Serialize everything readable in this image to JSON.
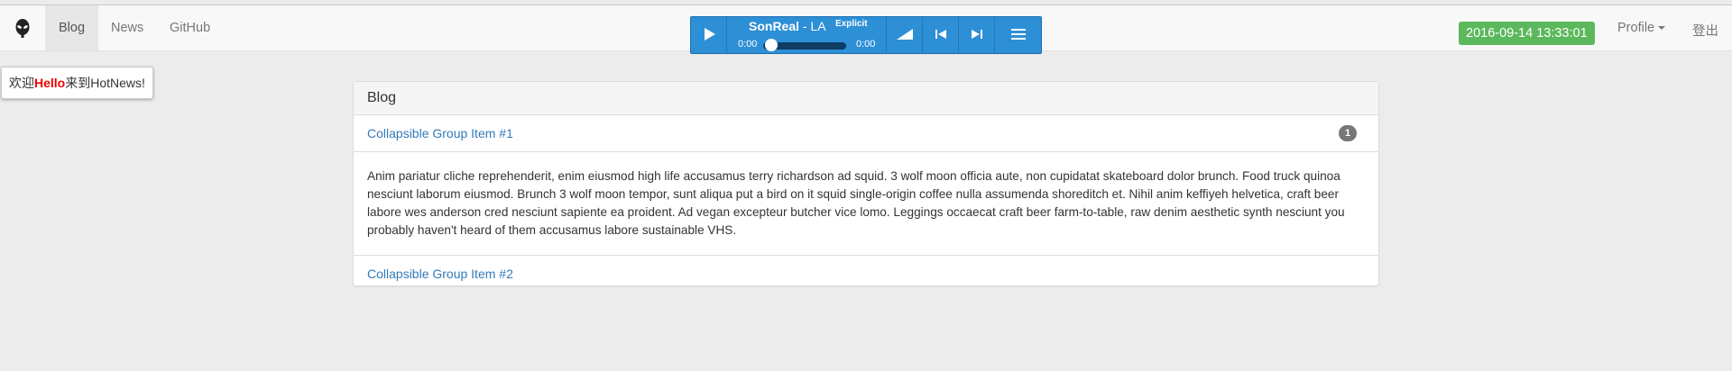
{
  "navbar": {
    "brand_icon": "alien-icon",
    "items": [
      {
        "label": "Blog",
        "active": true
      },
      {
        "label": "News",
        "active": false
      },
      {
        "label": "GitHub",
        "active": false
      }
    ],
    "clock": "2016-09-14 13:33:01",
    "profile_label": "Profile",
    "logout_label": "登出"
  },
  "player": {
    "artist": "SonReal",
    "separator": " - ",
    "title": "LA",
    "explicit_label": "Explicit",
    "time_current": "0:00",
    "time_total": "0:00",
    "progress": 0,
    "colors": {
      "background": "#2d8fd6",
      "track": "#0e3c63"
    }
  },
  "welcome": {
    "prefix": "欢迎",
    "name": "Hello",
    "suffix": "来到HotNews!"
  },
  "panel": {
    "title": "Blog",
    "groups": [
      {
        "label": "Collapsible Group Item #1",
        "count": "1",
        "body": "Anim pariatur cliche reprehenderit, enim eiusmod high life accusamus terry richardson ad squid. 3 wolf moon officia aute, non cupidatat skateboard dolor brunch. Food truck quinoa nesciunt laborum eiusmod. Brunch 3 wolf moon tempor, sunt aliqua put a bird on it squid single-origin coffee nulla assumenda shoreditch et. Nihil anim keffiyeh helvetica, craft beer labore wes anderson cred nesciunt sapiente ea proident. Ad vegan excepteur butcher vice lomo. Leggings occaecat craft beer farm-to-table, raw denim aesthetic synth nesciunt you probably haven't heard of them accusamus labore sustainable VHS."
      },
      {
        "label": "Collapsible Group Item #2"
      }
    ]
  },
  "colors": {
    "clock_badge": "#5cb85c",
    "link": "#337ab7",
    "welcome_highlight": "#ee0000"
  }
}
